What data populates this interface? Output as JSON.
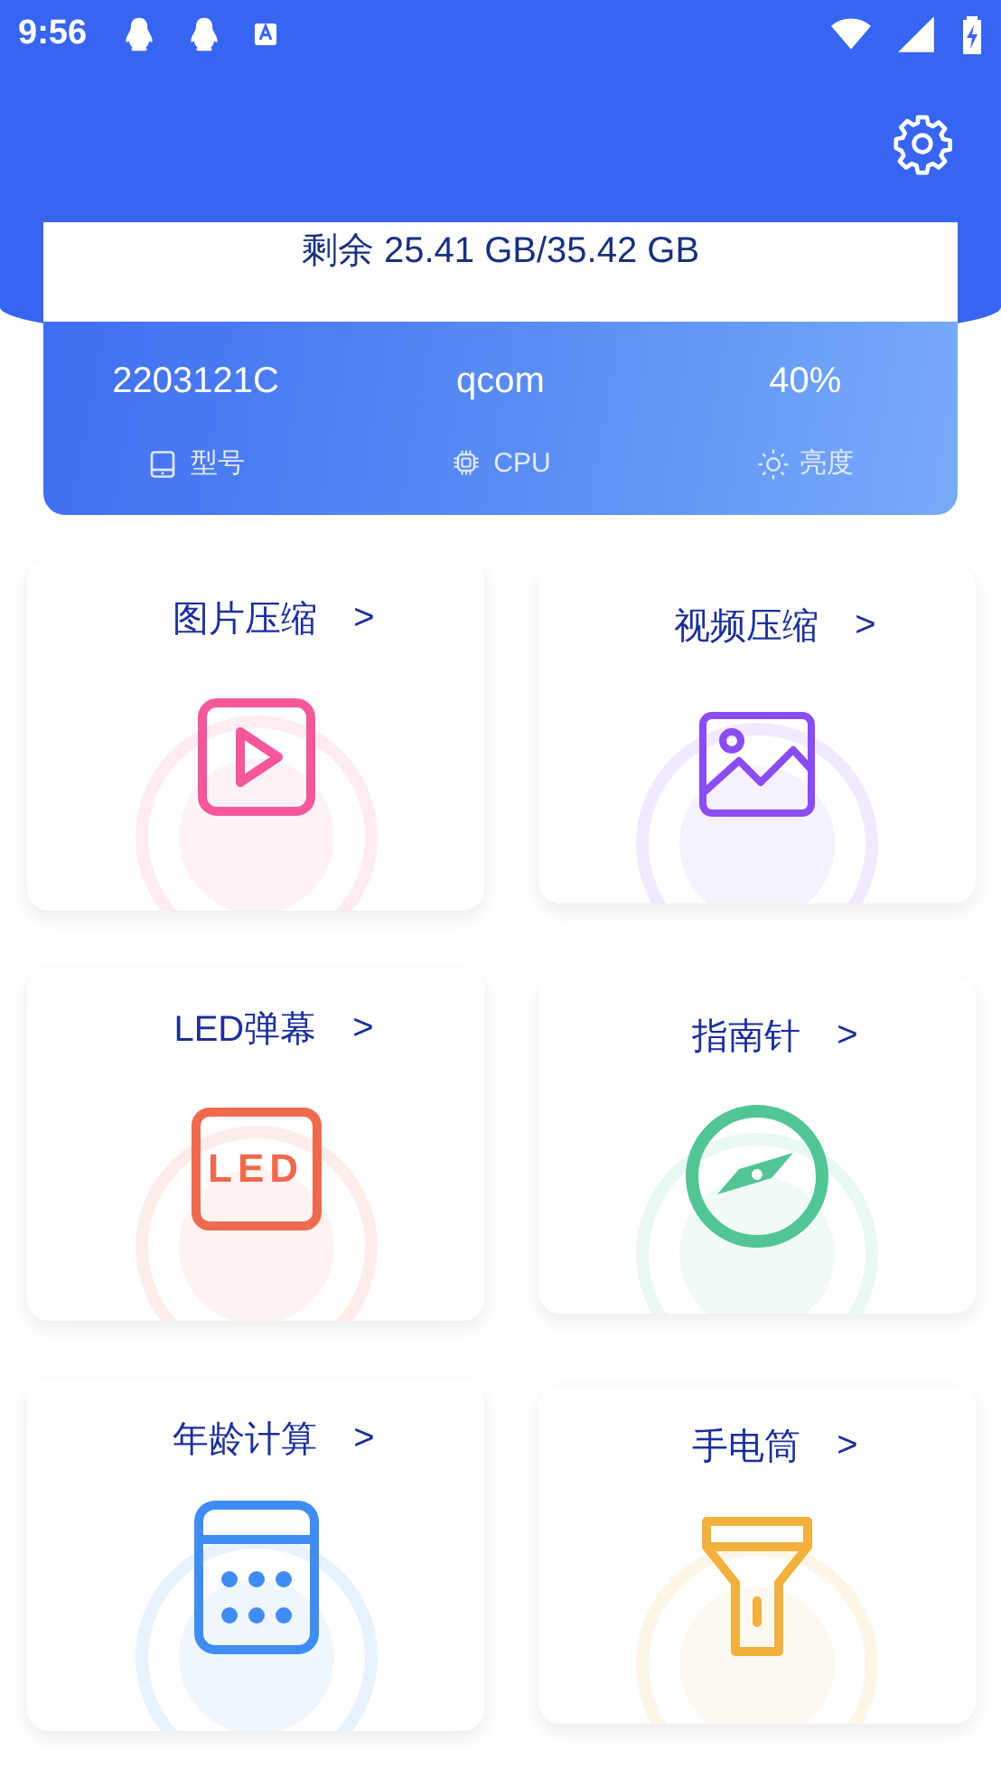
{
  "status_bar": {
    "time": "9:56"
  },
  "storage": {
    "text": "剩余 25.41 GB/35.42 GB"
  },
  "device_info": [
    {
      "value": "2203121C",
      "label": "型号",
      "kind": "model"
    },
    {
      "value": "qcom",
      "label": "CPU",
      "kind": "cpu"
    },
    {
      "value": "40%",
      "label": "亮度",
      "kind": "brightness"
    }
  ],
  "tools": [
    {
      "title": "图片压缩",
      "arrow": ">",
      "kind": "play",
      "color": "#f5579a"
    },
    {
      "title": "视频压缩",
      "arrow": ">",
      "kind": "image",
      "color": "#8a4cf5"
    },
    {
      "title": "LED弹幕",
      "arrow": ">",
      "kind": "led",
      "color": "#ee6a4e",
      "icon_text": "LED"
    },
    {
      "title": "指南针",
      "arrow": ">",
      "kind": "compass",
      "color": "#52c594"
    },
    {
      "title": "年龄计算",
      "arrow": ">",
      "kind": "calculator",
      "color": "#3f8cf5"
    },
    {
      "title": "手电筒",
      "arrow": ">",
      "kind": "flashlight",
      "color": "#f2b13c"
    }
  ]
}
